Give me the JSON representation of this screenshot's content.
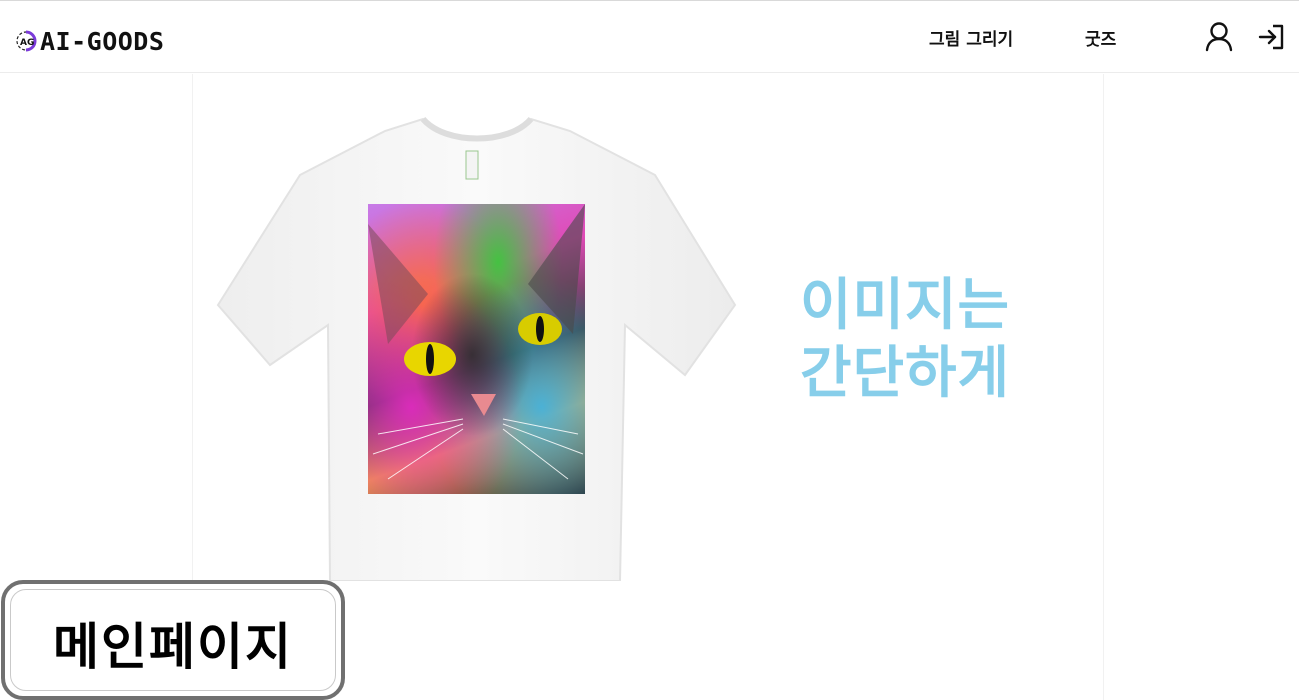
{
  "brand": {
    "logo_text": "AI-GOODS",
    "logo_mark_letters": "AG",
    "logo_icon": "ag-logo-icon"
  },
  "nav": {
    "links": [
      {
        "label": "그림 그리기"
      },
      {
        "label": "굿즈"
      }
    ],
    "user_icon": "user-icon",
    "login_icon": "login-icon"
  },
  "hero": {
    "headline_line1": "이미지는",
    "headline_line2": "간단하게",
    "headline_color": "#87ceea",
    "product_image": "tshirt-with-colorful-cat-print"
  },
  "page_label": {
    "text": "메인페이지"
  }
}
